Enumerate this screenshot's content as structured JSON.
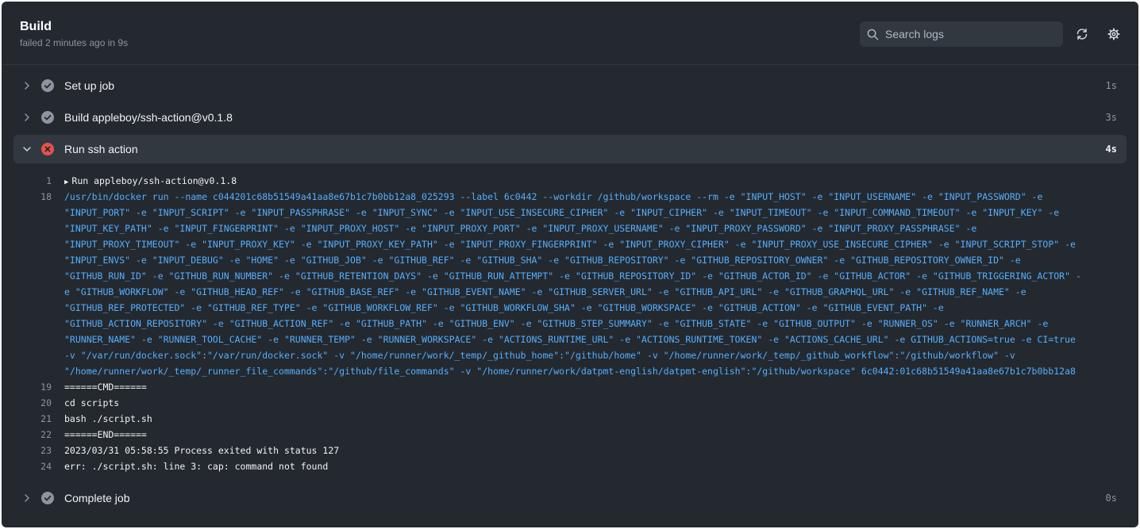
{
  "header": {
    "title": "Build",
    "subtitle": "failed 2 minutes ago in 9s",
    "search_placeholder": "Search logs"
  },
  "steps": [
    {
      "name": "Set up job",
      "duration": "1s",
      "status": "success",
      "expanded": false
    },
    {
      "name": "Build appleboy/ssh-action@v0.1.8",
      "duration": "3s",
      "status": "success",
      "expanded": false
    },
    {
      "name": "Run ssh action",
      "duration": "4s",
      "status": "failure",
      "expanded": true
    },
    {
      "name": "Complete job",
      "duration": "0s",
      "status": "success",
      "expanded": false
    }
  ],
  "log": {
    "group_line": {
      "num": "1",
      "text": "Run appleboy/ssh-action@v0.1.8"
    },
    "docker_num": "18",
    "docker_lines": [
      "/usr/bin/docker run --name c044201c68b51549a41aa8e67b1c7b0bb12a8_025293 --label 6c0442 --workdir /github/workspace --rm -e \"INPUT_HOST\" -e \"INPUT_USERNAME\" -e \"INPUT_PASSWORD\" -e",
      "\"INPUT_PORT\" -e \"INPUT_SCRIPT\" -e \"INPUT_PASSPHRASE\" -e \"INPUT_SYNC\" -e \"INPUT_USE_INSECURE_CIPHER\" -e \"INPUT_CIPHER\" -e \"INPUT_TIMEOUT\" -e \"INPUT_COMMAND_TIMEOUT\" -e \"INPUT_KEY\" -e",
      "\"INPUT_KEY_PATH\" -e \"INPUT_FINGERPRINT\" -e \"INPUT_PROXY_HOST\" -e \"INPUT_PROXY_PORT\" -e \"INPUT_PROXY_USERNAME\" -e \"INPUT_PROXY_PASSWORD\" -e \"INPUT_PROXY_PASSPHRASE\" -e",
      "\"INPUT_PROXY_TIMEOUT\" -e \"INPUT_PROXY_KEY\" -e \"INPUT_PROXY_KEY_PATH\" -e \"INPUT_PROXY_FINGERPRINT\" -e \"INPUT_PROXY_CIPHER\" -e \"INPUT_PROXY_USE_INSECURE_CIPHER\" -e \"INPUT_SCRIPT_STOP\" -e",
      "\"INPUT_ENVS\" -e \"INPUT_DEBUG\" -e \"HOME\" -e \"GITHUB_JOB\" -e \"GITHUB_REF\" -e \"GITHUB_SHA\" -e \"GITHUB_REPOSITORY\" -e \"GITHUB_REPOSITORY_OWNER\" -e \"GITHUB_REPOSITORY_OWNER_ID\" -e",
      "\"GITHUB_RUN_ID\" -e \"GITHUB_RUN_NUMBER\" -e \"GITHUB_RETENTION_DAYS\" -e \"GITHUB_RUN_ATTEMPT\" -e \"GITHUB_REPOSITORY_ID\" -e \"GITHUB_ACTOR_ID\" -e \"GITHUB_ACTOR\" -e \"GITHUB_TRIGGERING_ACTOR\" -",
      "e \"GITHUB_WORKFLOW\" -e \"GITHUB_HEAD_REF\" -e \"GITHUB_BASE_REF\" -e \"GITHUB_EVENT_NAME\" -e \"GITHUB_SERVER_URL\" -e \"GITHUB_API_URL\" -e \"GITHUB_GRAPHQL_URL\" -e \"GITHUB_REF_NAME\" -e",
      "\"GITHUB_REF_PROTECTED\" -e \"GITHUB_REF_TYPE\" -e \"GITHUB_WORKFLOW_REF\" -e \"GITHUB_WORKFLOW_SHA\" -e \"GITHUB_WORKSPACE\" -e \"GITHUB_ACTION\" -e \"GITHUB_EVENT_PATH\" -e",
      "\"GITHUB_ACTION_REPOSITORY\" -e \"GITHUB_ACTION_REF\" -e \"GITHUB_PATH\" -e \"GITHUB_ENV\" -e \"GITHUB_STEP_SUMMARY\" -e \"GITHUB_STATE\" -e \"GITHUB_OUTPUT\" -e \"RUNNER_OS\" -e \"RUNNER_ARCH\" -e",
      "\"RUNNER_NAME\" -e \"RUNNER_TOOL_CACHE\" -e \"RUNNER_TEMP\" -e \"RUNNER_WORKSPACE\" -e \"ACTIONS_RUNTIME_URL\" -e \"ACTIONS_RUNTIME_TOKEN\" -e \"ACTIONS_CACHE_URL\" -e GITHUB_ACTIONS=true -e CI=true",
      "-v \"/var/run/docker.sock\":\"/var/run/docker.sock\" -v \"/home/runner/work/_temp/_github_home\":\"/github/home\" -v \"/home/runner/work/_temp/_github_workflow\":\"/github/workflow\" -v",
      "\"/home/runner/work/_temp/_runner_file_commands\":\"/github/file_commands\" -v \"/home/runner/work/datpmt-english/datpmt-english\":\"/github/workspace\" 6c0442:01c68b51549a41aa8e67b1c7b0bb12a8"
    ],
    "lines": [
      {
        "num": "19",
        "text": "======CMD======"
      },
      {
        "num": "20",
        "text": "cd scripts"
      },
      {
        "num": "21",
        "text": "bash ./script.sh"
      },
      {
        "num": "22",
        "text": "======END======"
      },
      {
        "num": "23",
        "text": "2023/03/31 05:58:55 Process exited with status 127"
      },
      {
        "num": "24",
        "text": "err: ./script.sh: line 3: cap: command not found"
      }
    ]
  },
  "colors": {
    "background": "#24292f",
    "active_step": "#32383f",
    "success_icon": "#8c959f",
    "failure_icon": "#e5534b",
    "command_text": "#54aeff"
  }
}
